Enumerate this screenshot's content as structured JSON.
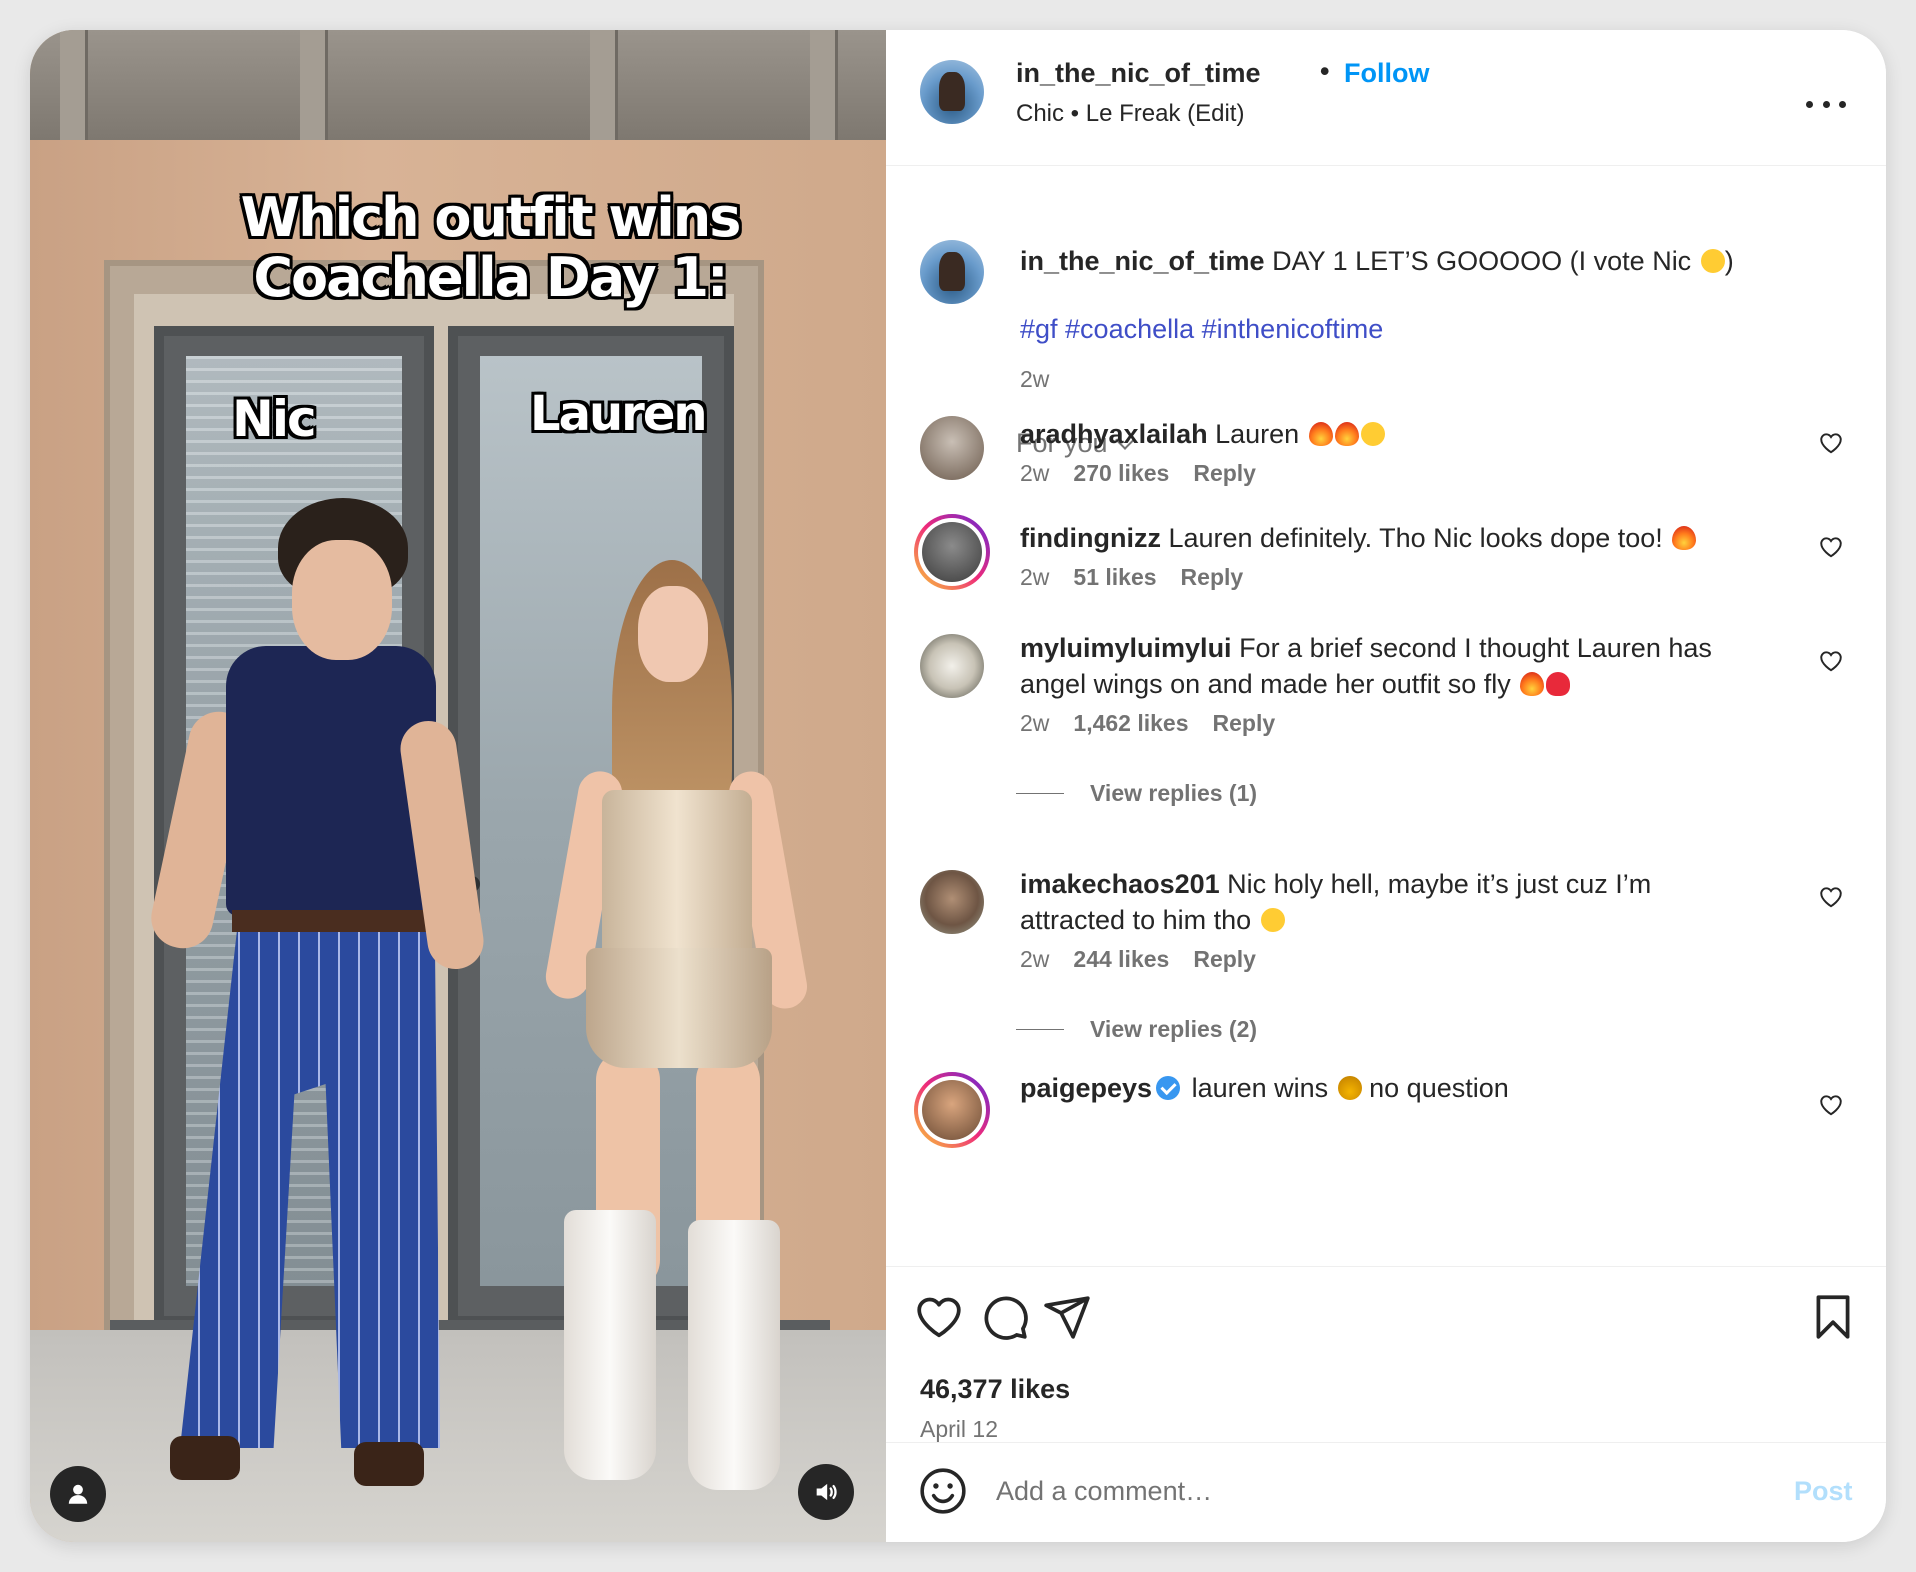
{
  "media": {
    "overlay_title": "Which outfit wins Coachella Day 1:",
    "label_left": "Nic",
    "label_right": "Lauren"
  },
  "header": {
    "username": "in_the_nic_of_time",
    "separator": "•",
    "follow_label": "Follow",
    "audio": "Chic • Le Freak (Edit)"
  },
  "caption": {
    "username": "in_the_nic_of_time",
    "text": " DAY 1 LET’S GOOOOO (I vote Nic ",
    "text_end": ")",
    "hashtags": "#gf #coachella #inthenicoftime",
    "time": "2w"
  },
  "sort": {
    "label": "For you"
  },
  "comments": [
    {
      "username": "aradhyaxlailah",
      "text": " Lauren ",
      "time": "2w",
      "likes": "270 likes",
      "reply": "Reply"
    },
    {
      "username": "findingnizz",
      "text": " Lauren definitely. Tho Nic looks dope too! ",
      "time": "2w",
      "likes": "51 likes",
      "reply": "Reply"
    },
    {
      "username": "myluimyluimylui",
      "text": " For a brief second I thought Lauren has angel wings on and made her outfit so fly ",
      "time": "2w",
      "likes": "1,462 likes",
      "reply": "Reply",
      "view_replies": "View replies (1)"
    },
    {
      "username": "imakechaos201",
      "text": " Nic holy hell, maybe it’s just cuz I’m attracted to him tho ",
      "time": "2w",
      "likes": "244 likes",
      "reply": "Reply",
      "view_replies": "View replies (2)"
    },
    {
      "username": "paigepeys",
      "text": " lauren wins ",
      "text_end": " no question"
    }
  ],
  "footer": {
    "likes": "46,377 likes",
    "date": "April 12",
    "comment_placeholder": "Add a comment…",
    "post_label": "Post"
  },
  "colors": {
    "accent": "#0095f6",
    "hashtag": "#3f4ec7",
    "muted": "#737373",
    "post_disabled": "#b2dffc"
  }
}
